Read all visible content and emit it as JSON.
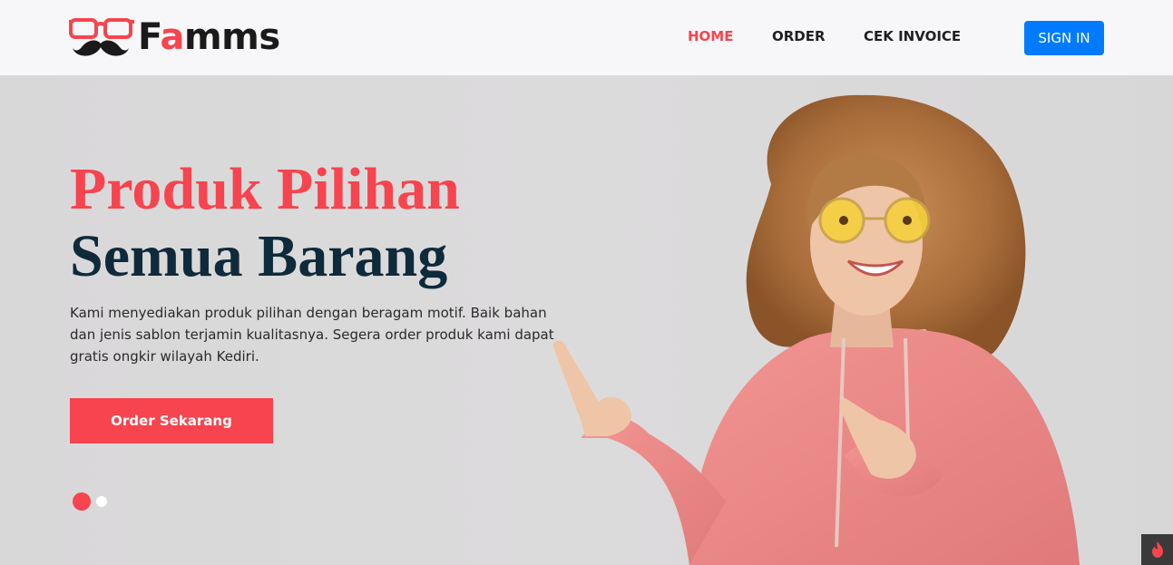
{
  "brand": {
    "name_prefix": "F",
    "name_accent": "a",
    "name_suffix": "mms"
  },
  "nav": {
    "items": [
      {
        "label": "HOME",
        "active": true
      },
      {
        "label": "ORDER",
        "active": false
      },
      {
        "label": "CEK INVOICE",
        "active": false
      }
    ],
    "signin_label": "SIGN IN"
  },
  "hero": {
    "title_line1": "Produk Pilihan",
    "title_line2": "Semua Barang",
    "description": "Kami menyediakan produk pilihan dengan beragam motif. Baik bahan dan jenis sablon terjamin kualitasnya. Segera order produk kami dapat gratis ongkir wilayah Kediri.",
    "cta_label": "Order Sekarang",
    "slides": {
      "count": 2,
      "active_index": 0
    }
  },
  "colors": {
    "accent": "#f7444e",
    "navy": "#0e2a3b",
    "signin": "#007bff",
    "navbar_bg": "#f7f7f9",
    "hoodie": "#ef8a8a",
    "hair": "#b57a45"
  },
  "icons": {
    "logo": "glasses-mustache-icon",
    "corner": "flame-icon"
  }
}
